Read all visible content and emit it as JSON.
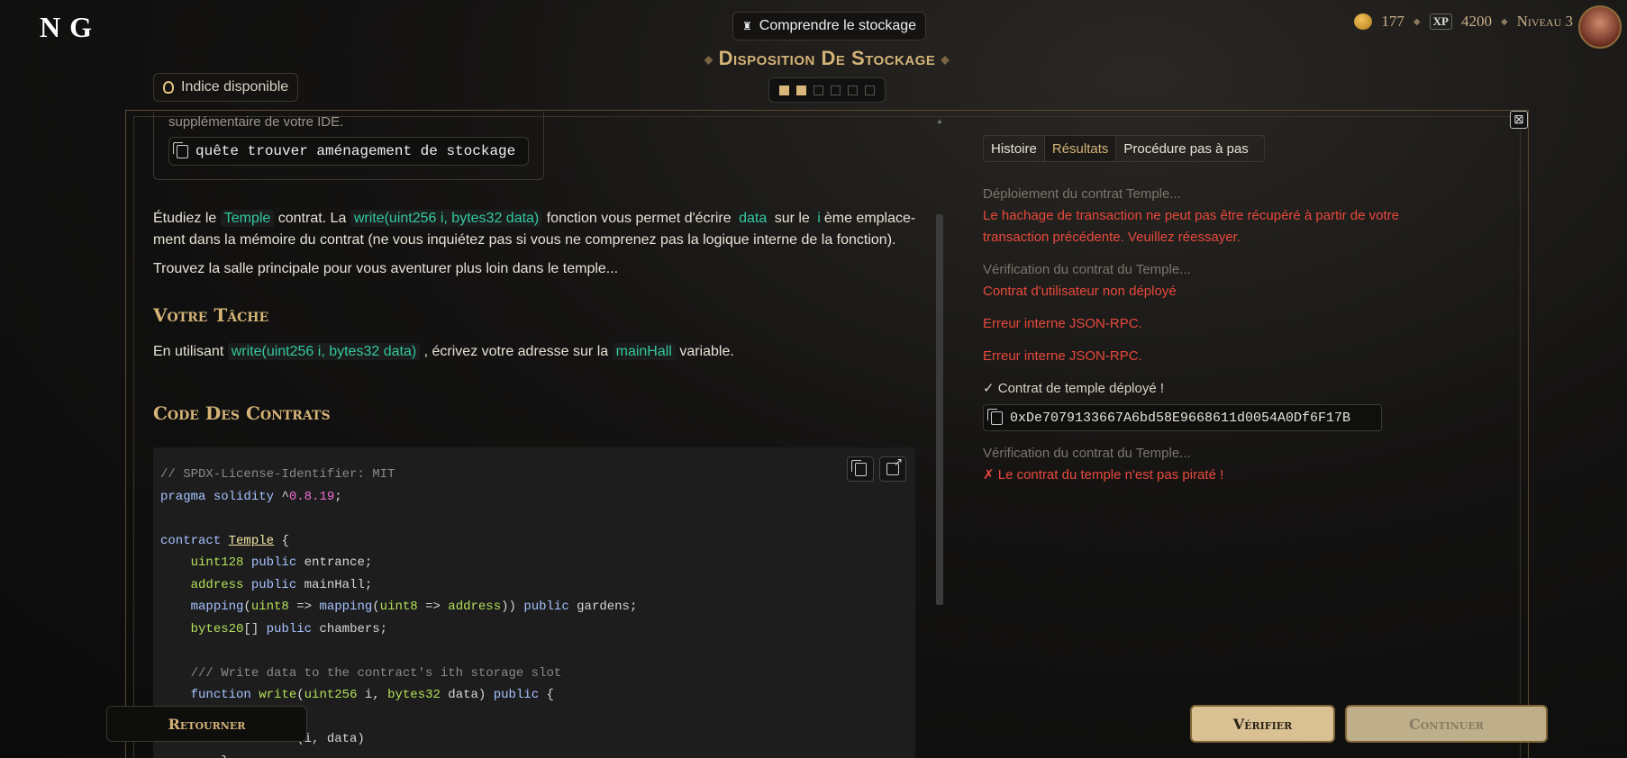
{
  "header": {
    "logo": "N G",
    "topic_button": "Comprendre le stockage",
    "gold": "177",
    "xp_label": "XP",
    "xp": "4200",
    "level": "Niveau 3"
  },
  "page_title": "Disposition De Stockage",
  "steps": {
    "total": 6,
    "completed": 2
  },
  "hint_button": "Indice disponible",
  "left": {
    "quest_note": "supplémentaire de votre IDE.",
    "quest_command": "quête trouver aménagement de stockage",
    "intro": {
      "p1_a": "Étudiez le",
      "p1_temple": "Temple",
      "p1_b": "contrat. La",
      "p1_write": "write(uint256 i, bytes32 data)",
      "p1_c": "fonction vous permet d'écrire",
      "p1_data": "data",
      "p1_d": "sur le",
      "p1_i": "i",
      "p1_e": "ème emplace-",
      "p1_line2": "ment dans la mémoire du contrat (ne vous inquiétez pas si vous ne comprenez pas la logique interne de la fonction).",
      "p2": "Trouvez la salle principale pour vous aventurer plus loin dans le temple..."
    },
    "task_heading": "Votre Tâche",
    "task": {
      "a": "En utilisant",
      "write": "write(uint256 i, bytes32 data)",
      "b": ", écrivez votre adresse sur la",
      "var": "mainHall",
      "c": "variable."
    },
    "code_heading": "Code Des Contrats"
  },
  "tabs": [
    "Histoire",
    "Résultats",
    "Procédure pas à pas"
  ],
  "active_tab": "Résultats",
  "results": {
    "l1": "Déploiement du contrat Temple...",
    "l2a": "Le hachage de transaction ne peut pas être récupéré à partir de votre",
    "l2b": "transaction précédente. Veuillez réessayer.",
    "l3": "Vérification du contrat du Temple...",
    "l4": "Contrat d'utilisateur non déployé",
    "l5": "Erreur interne JSON-RPC.",
    "l6": "Erreur interne JSON-RPC.",
    "l7": "✓ Contrat de temple déployé !",
    "address": "0xDe7079133667A6bd58E9668611d0054A0Df6F17B",
    "l8": "Vérification du contrat du Temple...",
    "l9": "✗ Le contrat du temple n'est pas piraté !"
  },
  "buttons": {
    "back": "Retourner",
    "verify": "Vérifier",
    "continue": "Continuer"
  }
}
